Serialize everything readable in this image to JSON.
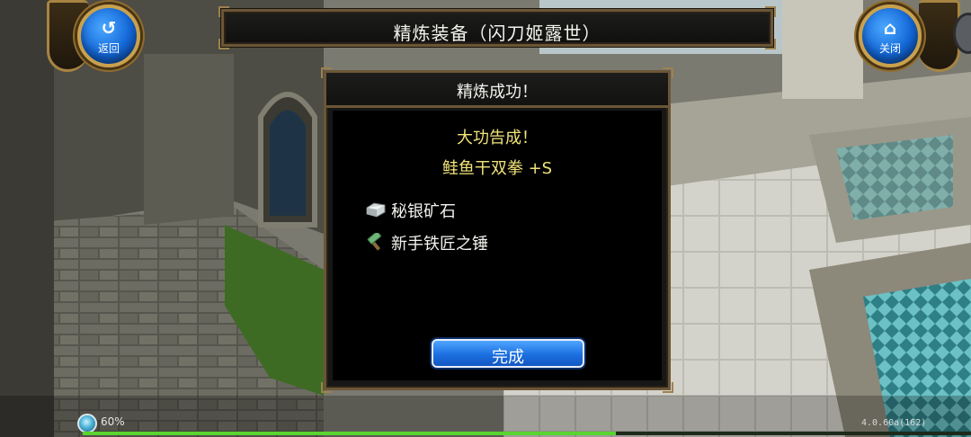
{
  "header": {
    "title": "精炼装备（闪刀姬露世）",
    "back_label": "返回",
    "close_label": "关闭"
  },
  "dialog": {
    "title": "精炼成功！",
    "headline": "大功告成！",
    "result_item": "鲑鱼干双拳 +S",
    "materials": [
      {
        "name": "秘银矿石",
        "icon": "ore-icon"
      },
      {
        "name": "新手铁匠之锤",
        "icon": "hammer-icon"
      }
    ],
    "done_label": "完成"
  },
  "status": {
    "percent_text": "60%",
    "progress": 0.6,
    "version": "4.0.60a(162)"
  },
  "colors": {
    "accent_gold": "#f1e37a",
    "frame_brown": "#6b5636",
    "button_blue": "#1c6fe0",
    "progress_green": "#5ad430"
  }
}
